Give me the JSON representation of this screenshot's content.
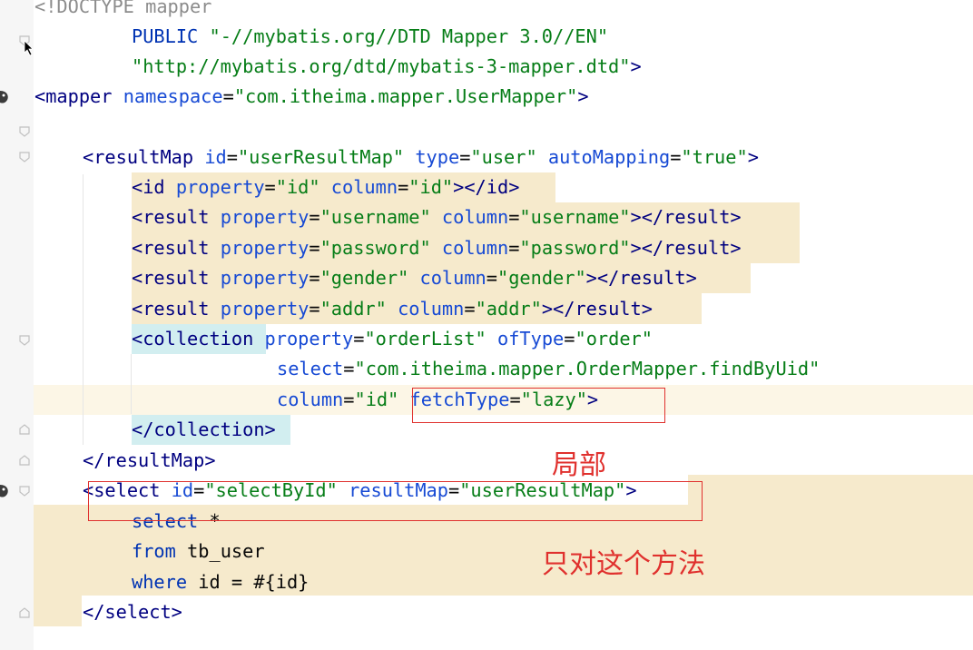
{
  "editor": {
    "lines": [
      {
        "tokens": [
          [
            "dim",
            "<!DOCTYPE mapper"
          ]
        ]
      },
      {
        "tokens": [
          [
            "kw",
            "PUBLIC "
          ],
          [
            "val",
            "\"-//mybatis.org//DTD Mapper 3.0//EN\""
          ]
        ]
      },
      {
        "tokens": [
          [
            "val",
            "\"http://mybatis.org/dtd/mybatis-3-mapper.dtd\""
          ],
          [
            "tag",
            ">"
          ]
        ]
      },
      {
        "tokens": [
          [
            "tag",
            "<mapper "
          ],
          [
            "attr",
            "namespace"
          ],
          [
            "txt",
            "="
          ],
          [
            "val",
            "\"com.itheima.mapper.UserMapper\""
          ],
          [
            "tag",
            ">"
          ]
        ]
      },
      {
        "tokens": []
      },
      {
        "tokens": [
          [
            "tag",
            "<resultMap "
          ],
          [
            "attr",
            "id"
          ],
          [
            "txt",
            "="
          ],
          [
            "val",
            "\"userResultMap\""
          ],
          [
            "attr",
            " type"
          ],
          [
            "txt",
            "="
          ],
          [
            "val",
            "\"user\""
          ],
          [
            "attr",
            " autoMapping"
          ],
          [
            "txt",
            "="
          ],
          [
            "val",
            "\"true\""
          ],
          [
            "tag",
            ">"
          ]
        ]
      },
      {
        "tokens": [
          [
            "tag",
            "<id "
          ],
          [
            "attr",
            "property"
          ],
          [
            "txt",
            "="
          ],
          [
            "val",
            "\"id\""
          ],
          [
            "attr",
            " column"
          ],
          [
            "txt",
            "="
          ],
          [
            "val",
            "\"id\""
          ],
          [
            "tag",
            "></id>"
          ]
        ]
      },
      {
        "tokens": [
          [
            "tag",
            "<result "
          ],
          [
            "attr",
            "property"
          ],
          [
            "txt",
            "="
          ],
          [
            "val",
            "\"username\""
          ],
          [
            "attr",
            " column"
          ],
          [
            "txt",
            "="
          ],
          [
            "val",
            "\"username\""
          ],
          [
            "tag",
            "></result>"
          ]
        ]
      },
      {
        "tokens": [
          [
            "tag",
            "<result "
          ],
          [
            "attr",
            "property"
          ],
          [
            "txt",
            "="
          ],
          [
            "val",
            "\"password\""
          ],
          [
            "attr",
            " column"
          ],
          [
            "txt",
            "="
          ],
          [
            "val",
            "\"password\""
          ],
          [
            "tag",
            "></result>"
          ]
        ]
      },
      {
        "tokens": [
          [
            "tag",
            "<result "
          ],
          [
            "attr",
            "property"
          ],
          [
            "txt",
            "="
          ],
          [
            "val",
            "\"gender\""
          ],
          [
            "attr",
            " column"
          ],
          [
            "txt",
            "="
          ],
          [
            "val",
            "\"gender\""
          ],
          [
            "tag",
            "></result>"
          ]
        ]
      },
      {
        "tokens": [
          [
            "tag",
            "<result "
          ],
          [
            "attr",
            "property"
          ],
          [
            "txt",
            "="
          ],
          [
            "val",
            "\"addr\""
          ],
          [
            "attr",
            " column"
          ],
          [
            "txt",
            "="
          ],
          [
            "val",
            "\"addr\""
          ],
          [
            "tag",
            "></result>"
          ]
        ]
      },
      {
        "tokens": [
          [
            "tag",
            "<collection"
          ],
          [
            "attr",
            " property"
          ],
          [
            "txt",
            "="
          ],
          [
            "val",
            "\"orderList\""
          ],
          [
            "attr",
            " ofType"
          ],
          [
            "txt",
            "="
          ],
          [
            "val",
            "\"order\""
          ]
        ]
      },
      {
        "tokens": [
          [
            "attr",
            "select"
          ],
          [
            "txt",
            "="
          ],
          [
            "val",
            "\"com.itheima.mapper.OrderMapper.findByUid\""
          ]
        ]
      },
      {
        "tokens": [
          [
            "attr",
            "column"
          ],
          [
            "txt",
            "="
          ],
          [
            "val",
            "\"id\""
          ],
          [
            "attr",
            " fetchType"
          ],
          [
            "txt",
            "="
          ],
          [
            "val",
            "\"lazy\""
          ],
          [
            "tag",
            ">"
          ]
        ]
      },
      {
        "tokens": [
          [
            "tag",
            "</collection>"
          ]
        ]
      },
      {
        "tokens": [
          [
            "tag",
            "</resultMap>"
          ]
        ]
      },
      {
        "tokens": [
          [
            "tag",
            "<select "
          ],
          [
            "attr",
            "id"
          ],
          [
            "txt",
            "="
          ],
          [
            "val",
            "\"selectById\""
          ],
          [
            "attr",
            " resultMap"
          ],
          [
            "txt",
            "="
          ],
          [
            "val",
            "\"userResultMap\""
          ],
          [
            "tag",
            ">"
          ]
        ]
      },
      {
        "tokens": [
          [
            "kw",
            "select "
          ],
          [
            "txt",
            "*"
          ]
        ]
      },
      {
        "tokens": [
          [
            "kw",
            "from "
          ],
          [
            "txt",
            "tb_user"
          ]
        ]
      },
      {
        "tokens": [
          [
            "kw",
            "where "
          ],
          [
            "txt",
            "id = #{id}"
          ]
        ]
      },
      {
        "tokens": [
          [
            "tag",
            "</select>"
          ]
        ]
      }
    ]
  },
  "annotations": {
    "label_local": "局部",
    "label_only_this_method": "只对这个方法"
  },
  "colors": {
    "annotation_red": "#e0312e",
    "highlight_yellow": "#f6eacc",
    "highlight_cyan": "#d2eef0",
    "caret_line": "#fcf6e6"
  }
}
